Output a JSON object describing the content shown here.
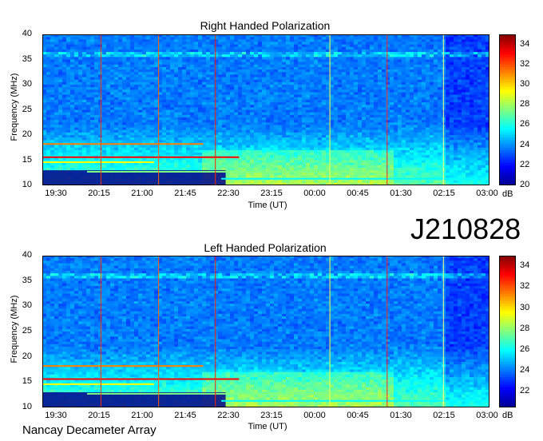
{
  "observation_id": "J210828",
  "instrument": "Nancay Decameter Array",
  "chart_data": [
    {
      "type": "heatmap",
      "title": "Right Handed Polarization",
      "xlabel": "Time (UT)",
      "ylabel": "Frequency (MHz)",
      "x_ticks": [
        "19:30",
        "20:15",
        "21:00",
        "21:45",
        "22:30",
        "23:15",
        "00:00",
        "00:45",
        "01:30",
        "02:15",
        "03:00"
      ],
      "y_ticks": [
        10,
        15,
        20,
        25,
        30,
        35,
        40
      ],
      "ylim": [
        10,
        40
      ],
      "colorbar": {
        "label": "dB",
        "ticks": [
          20,
          22,
          24,
          26,
          28,
          30,
          32,
          34
        ],
        "range": [
          20,
          35
        ]
      },
      "colormap": [
        "#00008f",
        "#0000ff",
        "#0080ff",
        "#00ffff",
        "#80ff80",
        "#ffff00",
        "#ff8000",
        "#ff0000",
        "#800000"
      ]
    },
    {
      "type": "heatmap",
      "title": "Left Handed Polarization",
      "xlabel": "Time (UT)",
      "ylabel": "Frequency (MHz)",
      "x_ticks": [
        "19:30",
        "20:15",
        "21:00",
        "21:45",
        "22:30",
        "23:15",
        "00:00",
        "00:45",
        "01:30",
        "02:15",
        "03:00"
      ],
      "y_ticks": [
        10,
        15,
        20,
        25,
        30,
        35,
        40
      ],
      "ylim": [
        10,
        40
      ],
      "colorbar": {
        "label": "dB",
        "ticks": [
          22,
          24,
          26,
          28,
          30,
          32,
          34
        ],
        "range": [
          20.5,
          35
        ]
      },
      "colormap": [
        "#00008f",
        "#0000ff",
        "#0080ff",
        "#00ffff",
        "#80ff80",
        "#ffff00",
        "#ff8000",
        "#ff0000",
        "#800000"
      ]
    }
  ]
}
